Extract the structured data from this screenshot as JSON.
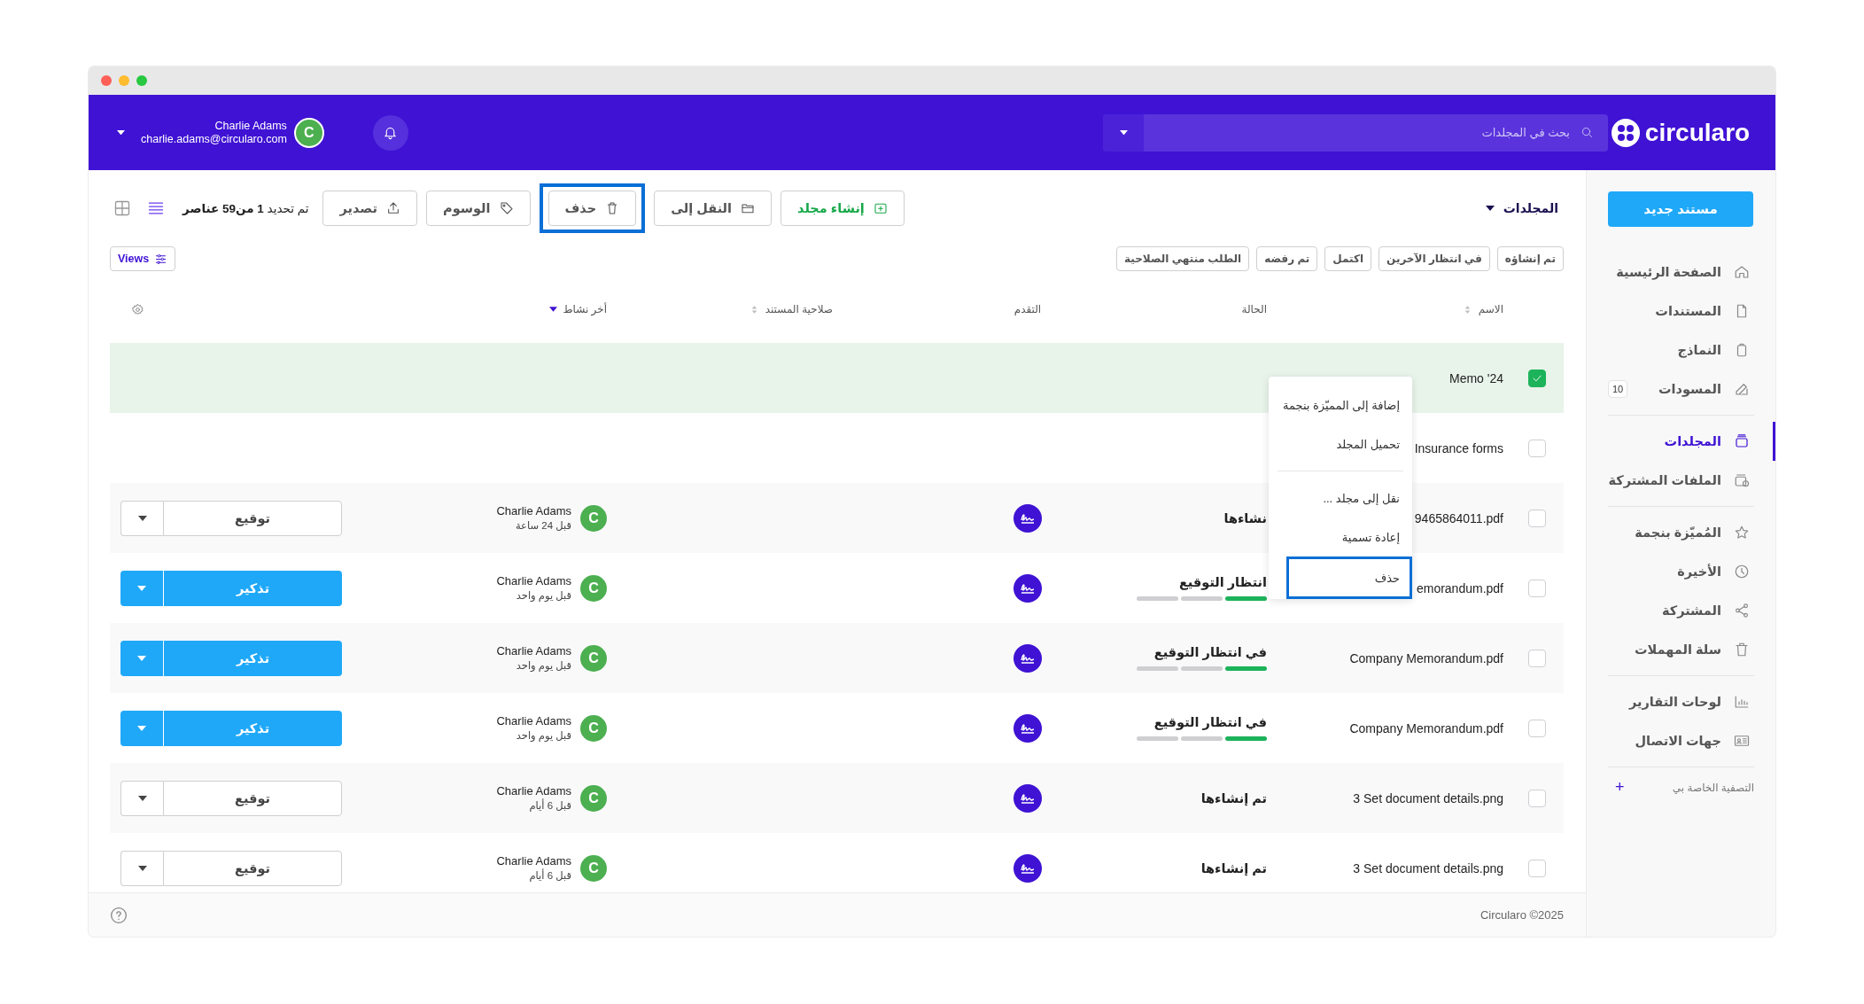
{
  "header": {
    "logo": "circularo",
    "search": {
      "placeholder": "بحث في المجلدات"
    },
    "user": {
      "name": "Charlie Adams",
      "email": "charlie.adams@circularo.com",
      "avatar": "C"
    }
  },
  "sidebar": {
    "new_button": "مستند جديد",
    "sections": [
      [
        {
          "label": "الصفحة الرئيسية",
          "selected": false
        },
        {
          "label": "المستندات",
          "selected": false
        },
        {
          "label": "النماذج",
          "selected": false
        },
        {
          "label": "المسودات",
          "selected": false,
          "badge": "10"
        }
      ],
      [
        {
          "label": "المجلدات",
          "selected": true
        },
        {
          "label": "الملفات المشتركة",
          "selected": false
        }
      ],
      [
        {
          "label": "المُميّزة بنجمة",
          "selected": false
        },
        {
          "label": "الأخيرة",
          "selected": false
        },
        {
          "label": "المشتركة",
          "selected": false
        },
        {
          "label": "سلة المهملات",
          "selected": false
        }
      ],
      [
        {
          "label": "لوحات التقارير",
          "selected": false
        },
        {
          "label": "جهات الاتصال",
          "selected": false
        }
      ]
    ],
    "filters": {
      "label": "التصفية الخاصة بي",
      "add": "+"
    }
  },
  "toolbar": {
    "folder_title": "المجلدات",
    "buttons": [
      {
        "label": "إنشاء مجلد",
        "kind": "create",
        "highlighted": false
      },
      {
        "label": "النقل إلى",
        "kind": "move",
        "highlighted": false
      },
      {
        "label": "حذف",
        "kind": "delete",
        "highlighted": true
      },
      {
        "label": "الوسوم",
        "kind": "tags",
        "highlighted": false
      },
      {
        "label": "تصدير",
        "kind": "export",
        "highlighted": false
      }
    ],
    "selection": "تم تحديد **1 من59 عناصر**",
    "view_modes": [
      {
        "kind": "list",
        "selected": true
      },
      {
        "kind": "grid",
        "selected": false
      }
    ]
  },
  "filter_chips": [
    "تم إنشاؤه",
    "في انتظار الآخرين",
    "اكتمل",
    "تم رفضه",
    "الطلب منتهي الصلاحية"
  ],
  "views_button": "Views",
  "table": {
    "columns": [
      {
        "label": "الاسم",
        "sortable": true
      },
      {
        "label": "الحالة"
      },
      {
        "label": "التقدم"
      },
      {
        "label": "صلاحية المستند",
        "sortable": true
      },
      {
        "label": "أخر نشاط",
        "sortable": true,
        "sorted": true
      }
    ],
    "rows": [
      {
        "name": "Memo '24",
        "checked": true
      },
      {
        "name": "Insurance forms",
        "checked": false
      },
      {
        "name": "9465864011.pdf",
        "checked": false,
        "status": "نشاءها",
        "activity": {
          "avatar": "C",
          "user": "Charlie Adams",
          "time": "قبل 24 ساعة"
        },
        "action": {
          "label": "توقيع",
          "kind": "outline"
        }
      },
      {
        "name": "emorandum.pdf",
        "checked": false,
        "status": "انتظار التوقيع",
        "level": 0.33,
        "activity": {
          "avatar": "C",
          "user": "Charlie Adams",
          "time": "قبل يوم واحد"
        },
        "action": {
          "label": "تذكير",
          "kind": "primary"
        }
      },
      {
        "name": "Company Memorandum.pdf",
        "checked": false,
        "status": "في انتظار التوقيع",
        "level": 0.33,
        "activity": {
          "avatar": "C",
          "user": "Charlie Adams",
          "time": "قبل يوم واحد"
        },
        "action": {
          "label": "تذكير",
          "kind": "primary"
        }
      },
      {
        "name": "Company Memorandum.pdf",
        "checked": false,
        "status": "في انتظار التوقيع",
        "level": 0.33,
        "activity": {
          "avatar": "C",
          "user": "Charlie Adams",
          "time": "قبل يوم واحد"
        },
        "action": {
          "label": "تذكير",
          "kind": "primary"
        }
      },
      {
        "name": "3 Set document details.png",
        "checked": false,
        "status": "تم إنشاءها",
        "activity": {
          "avatar": "C",
          "user": "Charlie Adams",
          "time": "قبل 6 أيام"
        },
        "action": {
          "label": "توقيع",
          "kind": "outline"
        }
      },
      {
        "name": "3 Set document details.png",
        "checked": false,
        "status": "تم إنشاءها",
        "activity": {
          "avatar": "C",
          "user": "Charlie Adams",
          "time": "قبل 6 أيام"
        },
        "action": {
          "label": "توقيع",
          "kind": "outline"
        }
      }
    ]
  },
  "context_menu": {
    "groups": [
      [
        {
          "label": "إضافة إلى المميّزة بنجمة",
          "highlighted": false
        },
        {
          "label": "تحميل المجلد",
          "highlighted": false
        }
      ],
      [
        {
          "label": "نقل إلى مجلد ...",
          "highlighted": false
        },
        {
          "label": "إعادة تسمية",
          "highlighted": false
        },
        {
          "label": "حذف",
          "highlighted": true
        }
      ]
    ]
  },
  "footer": {
    "copyright": "Circularo ©2025"
  }
}
